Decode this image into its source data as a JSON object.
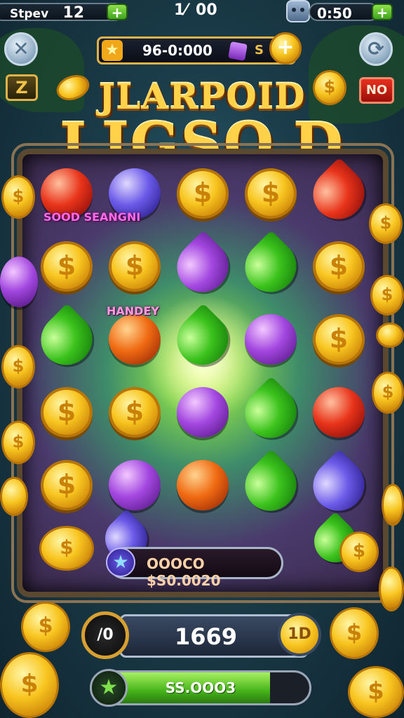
{
  "top_bar": {
    "left_label": "Stpev",
    "left_value": "12",
    "center_value": "1⁄  00",
    "right_value": "0:50"
  },
  "currency_bar": {
    "value": "96-0:000",
    "small_label": "S"
  },
  "buttons": {
    "close_icon": "close-icon",
    "refresh_icon": "refresh-icon",
    "left_square_label": "Z",
    "no_button_label": "NO"
  },
  "title": {
    "line1": "JLARPOID",
    "line2": "LJGSO.D"
  },
  "board": {
    "combo_label_1": "SOOD SEANGNI",
    "combo_label_2": "HANDEY",
    "grid": [
      [
        "red-orb",
        "blue-orb",
        "coin",
        "coin",
        "red-drop"
      ],
      [
        "coin",
        "coin",
        "purple-drop",
        "green-drop",
        "coin"
      ],
      [
        "green-drop",
        "orange-orb",
        "green-drop",
        "purple-orb",
        "coin"
      ],
      [
        "coin",
        "coin",
        "purple-orb",
        "green-drop",
        "red-orb"
      ],
      [
        "coin",
        "purple-orb",
        "orange-orb",
        "green-drop",
        "blue-drop"
      ]
    ]
  },
  "status_bar": {
    "text": "OOOCO $S0.0020",
    "icon": "star-icon"
  },
  "score_panel": {
    "left_badge": "/0",
    "value": "1669",
    "right_badge": "1D"
  },
  "progress_bar": {
    "text": "SS.OOO3",
    "fill_fraction": 0.82,
    "icon": "star-icon"
  },
  "colors": {
    "gold": "#ffd24a",
    "green_accent": "#46b41a",
    "magenta_label": "#ff6be8",
    "no_button": "#c81a12"
  }
}
